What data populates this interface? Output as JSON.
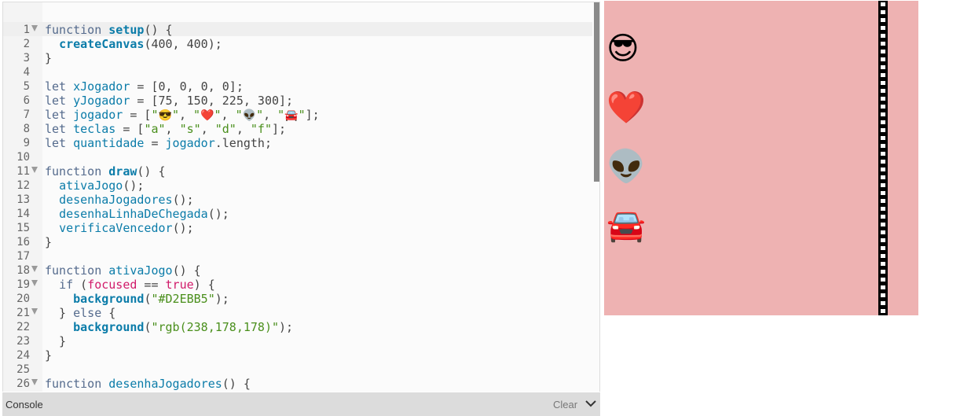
{
  "editor": {
    "lines": [
      {
        "n": "1",
        "fold": true,
        "html": "<span class=\"kw\">function</span> <span class=\"fn\">setup</span>() {"
      },
      {
        "n": "2",
        "fold": false,
        "html": "  <span class=\"fn\">createCanvas</span>(400, 400);"
      },
      {
        "n": "3",
        "fold": false,
        "html": "}"
      },
      {
        "n": "4",
        "fold": false,
        "html": ""
      },
      {
        "n": "5",
        "fold": false,
        "html": "<span class=\"kw\">let</span> <span class=\"var\">xJogador</span> = [0, 0, 0, 0];"
      },
      {
        "n": "6",
        "fold": false,
        "html": "<span class=\"kw\">let</span> <span class=\"var\">yJogador</span> = [75, 150, 225, 300];"
      },
      {
        "n": "7",
        "fold": false,
        "html": "<span class=\"kw\">let</span> <span class=\"var\">jogador</span> = [<span class=\"str\">\"<span class=\"emo\">😎</span>\"</span>, <span class=\"str\">\"<span class=\"emo\">❤️</span>\"</span>, <span class=\"str\">\"<span class=\"emo\">👽</span>\"</span>, <span class=\"str\">\"<span class=\"emo\">🚘</span>\"</span>];"
      },
      {
        "n": "8",
        "fold": false,
        "html": "<span class=\"kw\">let</span> <span class=\"var\">teclas</span> = [<span class=\"str\">\"a\"</span>, <span class=\"str\">\"s\"</span>, <span class=\"str\">\"d\"</span>, <span class=\"str\">\"f\"</span>];"
      },
      {
        "n": "9",
        "fold": false,
        "html": "<span class=\"kw\">let</span> <span class=\"var\">quantidade</span> = <span class=\"var\">jogador</span>.length;"
      },
      {
        "n": "10",
        "fold": false,
        "html": ""
      },
      {
        "n": "11",
        "fold": true,
        "html": "<span class=\"kw\">function</span> <span class=\"fn\">draw</span>() {"
      },
      {
        "n": "12",
        "fold": false,
        "html": "  <span class=\"call\">ativaJogo</span>();"
      },
      {
        "n": "13",
        "fold": false,
        "html": "  <span class=\"call\">desenhaJogadores</span>();"
      },
      {
        "n": "14",
        "fold": false,
        "html": "  <span class=\"call\">desenhaLinhaDeChegada</span>();"
      },
      {
        "n": "15",
        "fold": false,
        "html": "  <span class=\"call\">verificaVencedor</span>();"
      },
      {
        "n": "16",
        "fold": false,
        "html": "}"
      },
      {
        "n": "17",
        "fold": false,
        "html": ""
      },
      {
        "n": "18",
        "fold": true,
        "html": "<span class=\"kw\">function</span> <span class=\"call\">ativaJogo</span>() {"
      },
      {
        "n": "19",
        "fold": true,
        "html": "  <span class=\"kw\">if</span> (<span class=\"bool\">focused</span> == <span class=\"bool\">true</span>) {"
      },
      {
        "n": "20",
        "fold": false,
        "html": "    <span class=\"fn\">background</span>(<span class=\"str\">\"#D2EBB5\"</span>);"
      },
      {
        "n": "21",
        "fold": true,
        "html": "  } <span class=\"kw\">else</span> {"
      },
      {
        "n": "22",
        "fold": false,
        "html": "    <span class=\"fn\">background</span>(<span class=\"str\">\"rgb(238,178,178)\"</span>);"
      },
      {
        "n": "23",
        "fold": false,
        "html": "  }"
      },
      {
        "n": "24",
        "fold": false,
        "html": "}"
      },
      {
        "n": "25",
        "fold": false,
        "html": ""
      },
      {
        "n": "26",
        "fold": true,
        "html": "<span class=\"kw\">function</span> <span class=\"call\">desenhaJogadores</span>() {"
      }
    ]
  },
  "console": {
    "title": "Console",
    "clear_label": "Clear"
  },
  "preview": {
    "background": "#eeb2b2",
    "players": [
      {
        "emoji": "😎",
        "name": "sunglasses-face-icon"
      },
      {
        "emoji": "❤️",
        "name": "heart-icon"
      },
      {
        "emoji": "👽",
        "name": "alien-icon"
      },
      {
        "emoji": "🚘",
        "name": "car-icon"
      }
    ]
  }
}
